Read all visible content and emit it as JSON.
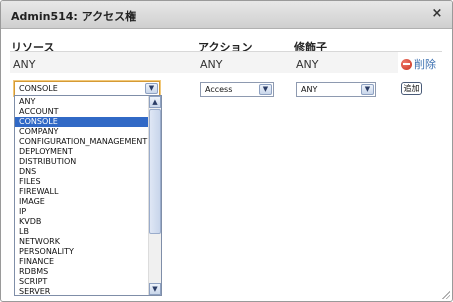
{
  "dialog": {
    "title": "Admin514: アクセス権",
    "close_glyph": "×"
  },
  "columns": {
    "resource": "リソース",
    "action": "アクション",
    "modifier": "修飾子"
  },
  "existing_row": {
    "resource": "ANY",
    "action": "ANY",
    "modifier": "ANY",
    "delete_label": "削除"
  },
  "new_row": {
    "resource_value": "CONSOLE",
    "action_value": "Access",
    "modifier_value": "ANY",
    "add_label": "追加"
  },
  "resource_options": [
    "ANY",
    "ACCOUNT",
    "CONSOLE",
    "COMPANY",
    "CONFIGURATION_MANAGEMENT",
    "DEPLOYMENT",
    "DISTRIBUTION",
    "DNS",
    "FILES",
    "FIREWALL",
    "IMAGE",
    "IP",
    "KVDB",
    "LB",
    "NETWORK",
    "PERSONALITY",
    "FINANCE",
    "RDBMS",
    "SCRIPT",
    "SERVER"
  ],
  "selected_option_index": 2,
  "colors": {
    "selection": "#3169c6",
    "focus_border": "#d59a35",
    "link": "#3a6fb0",
    "delete_icon": "#c8321f"
  }
}
